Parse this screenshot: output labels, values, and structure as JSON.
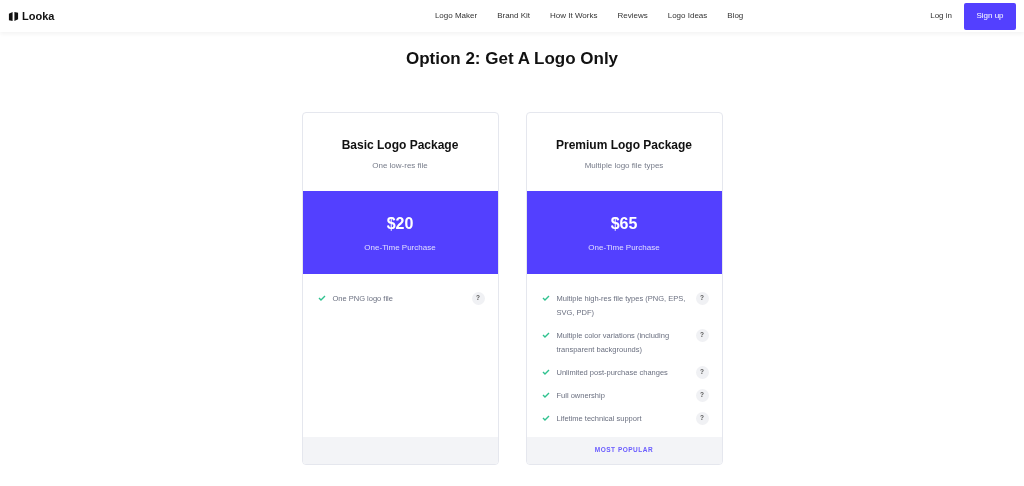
{
  "nav": {
    "brand": "Looka",
    "links": [
      "Logo Maker",
      "Brand Kit",
      "How It Works",
      "Reviews",
      "Logo Ideas",
      "Blog"
    ],
    "login": "Log in",
    "signup": "Sign up"
  },
  "heading": "Option 2: Get A Logo Only",
  "plans": [
    {
      "name": "Basic Logo Package",
      "subtitle": "One low-res file",
      "price": "$20",
      "price_note": "One-Time Purchase",
      "features": [
        "One PNG logo file"
      ],
      "help_mark": "?"
    },
    {
      "name": "Premium Logo Package",
      "subtitle": "Multiple logo file types",
      "price": "$65",
      "price_note": "One-Time Purchase",
      "features": [
        "Multiple high-res file types (PNG, EPS, SVG, PDF)",
        "Multiple color variations (including transparent backgrounds)",
        "Unlimited post-purchase changes",
        "Full ownership",
        "Lifetime technical support"
      ],
      "help_mark": "?",
      "footer_label": "MOST POPULAR"
    }
  ]
}
